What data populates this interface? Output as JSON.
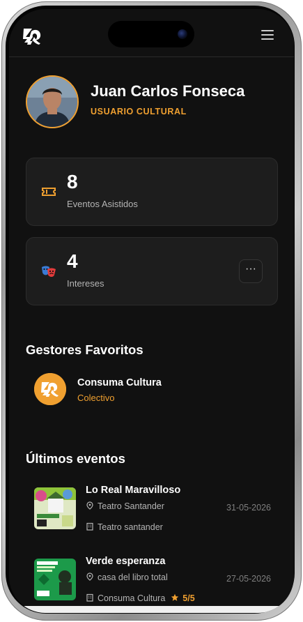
{
  "app": {
    "logo": "consuma-cultura-logo"
  },
  "profile": {
    "name": "Juan Carlos Fonseca",
    "role": "USUARIO CULTURAL"
  },
  "stats": [
    {
      "icon": "ticket-icon",
      "value": "8",
      "label": "Eventos Asistidos"
    },
    {
      "icon": "theater-masks-icon",
      "value": "4",
      "label": "Intereses",
      "more": "···"
    }
  ],
  "favorites": {
    "title": "Gestores Favoritos",
    "items": [
      {
        "name": "Consuma Cultura",
        "type": "Colectivo"
      }
    ]
  },
  "events": {
    "title": "Últimos eventos",
    "items": [
      {
        "title": "Lo Real Maravilloso",
        "venue": "Teatro Santander",
        "organizer": "Teatro santander",
        "date": "31-05-2026"
      },
      {
        "title": "Verde esperanza",
        "venue": "casa del libro total",
        "organizer": "Consuma Cultura",
        "date": "27-05-2026",
        "rating": "5/5"
      }
    ]
  },
  "colors": {
    "accent": "#f0a030",
    "background": "#111111",
    "card": "#1d1d1d"
  }
}
